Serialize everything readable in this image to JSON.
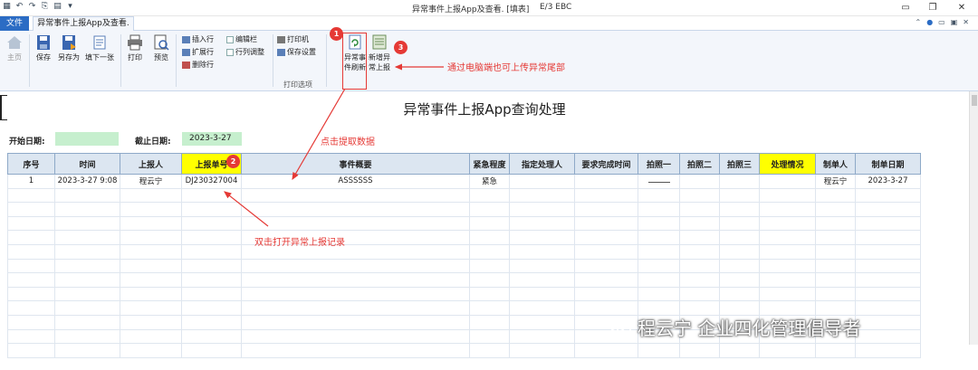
{
  "window": {
    "title": "异常事件上报App及查看. [填表]",
    "subtitle": "E/3 EBC"
  },
  "tabs": {
    "file": "文件",
    "active": "异常事件上报App及查看."
  },
  "ribbon": {
    "home": "主页",
    "save": "保存",
    "save_as": "另存为",
    "fill_next": "填下一张",
    "print": "打印",
    "preview": "预览",
    "insert_row": "插入行",
    "expand_row": "扩展行",
    "delete_row": "删除行",
    "edit_bar": "编辑栏",
    "row_col_adjust": "行列调整",
    "printer": "打印机",
    "save_settings": "保存设置",
    "print_options_group": "打印选项",
    "refresh_btn_line1": "异常事",
    "refresh_btn_line2": "件刷新",
    "new_btn_line1": "新增异",
    "new_btn_line2": "常上报"
  },
  "annotations": {
    "badge1": "1",
    "badge2": "2",
    "badge3": "3",
    "note_upload": "通过电脑端也可上传异常尾部",
    "note_fetch": "点击提取数据",
    "note_dblclick": "双击打开异常上报记录"
  },
  "report": {
    "title": "异常事件上报App查询处理",
    "start_label": "开始日期:",
    "start_value": "",
    "end_label": "截止日期:",
    "end_value": "2023-3-27"
  },
  "table": {
    "headers": [
      "序号",
      "时间",
      "上报人",
      "上报单号",
      "事件概要",
      "紧急程度",
      "指定处理人",
      "要求完成时间",
      "拍照一",
      "拍照二",
      "拍照三",
      "处理情况",
      "制单人",
      "制单日期"
    ],
    "rows": [
      [
        "1",
        "2023-3-27 9:08",
        "程云宁",
        "DJ230327004",
        "ASSSSSS",
        "紧急",
        "",
        "",
        "",
        "",
        "",
        "",
        "程云宁",
        "2023-3-27"
      ]
    ],
    "empty_rows": 12
  },
  "watermark": {
    "text": "程云宁 企业四化管理倡导者"
  },
  "colors": {
    "accent": "#2b6cc4",
    "annotation": "#e53935",
    "header_fill": "#dce6f1",
    "highlight": "#ffff00",
    "date_fill": "#c6efce"
  }
}
